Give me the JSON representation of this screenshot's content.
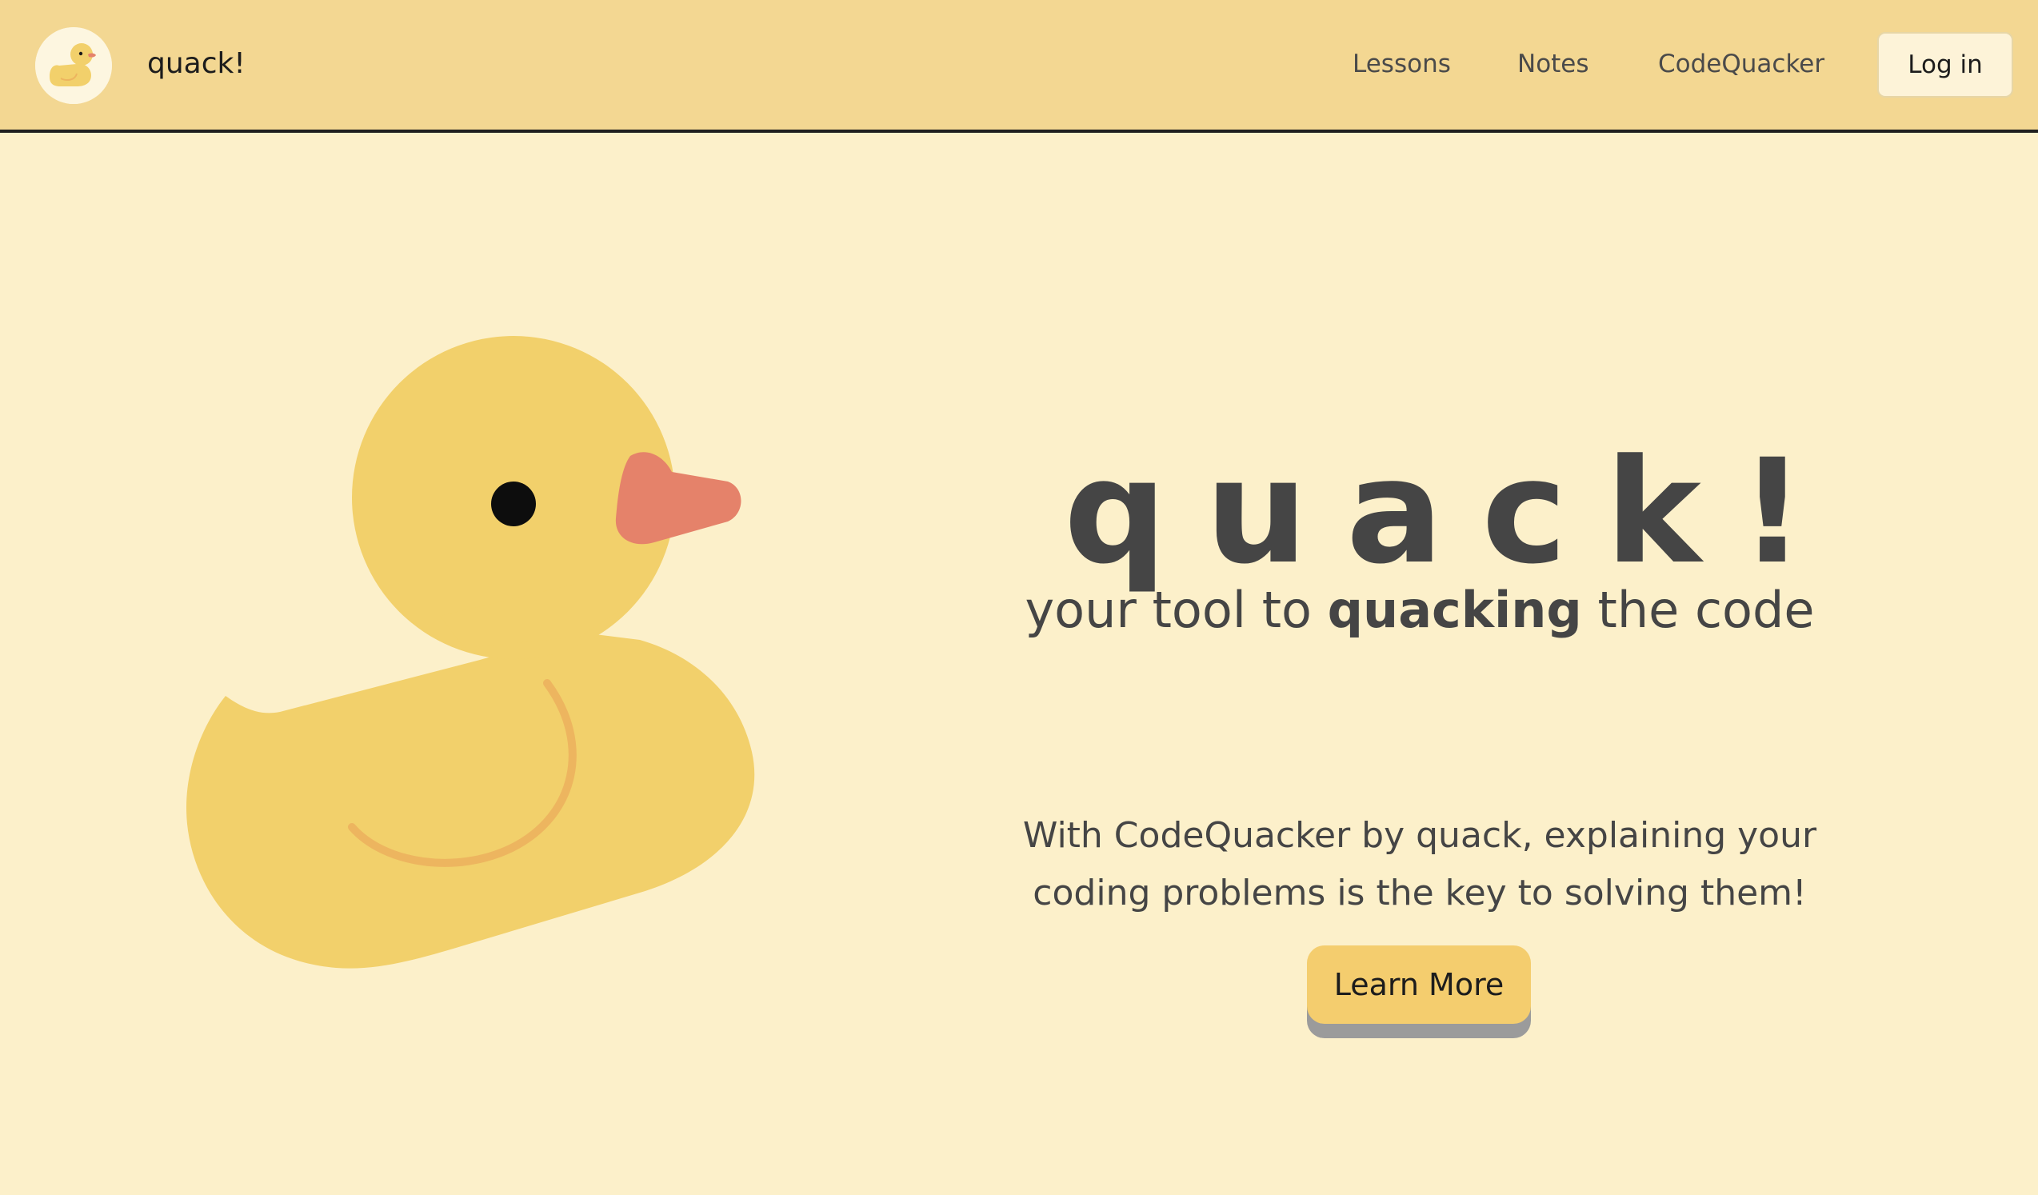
{
  "navbar": {
    "brand": {
      "logo_icon": "duck-logo-icon",
      "name": "quack!"
    },
    "links": [
      {
        "label": "Lessons"
      },
      {
        "label": "Notes"
      },
      {
        "label": "CodeQuacker"
      }
    ],
    "login_label": "Log in"
  },
  "hero": {
    "image_icon": "rubber-duck-illustration",
    "title": "quack!",
    "tagline": {
      "before": "your tool to",
      "emphasis": "quacking",
      "after": "the code"
    },
    "description": "With CodeQuacker by quack, explaining your coding problems is the key to solving them!",
    "cta_label": "Learn More"
  },
  "colors": {
    "page_background": "#fcf0ca",
    "navbar_background": "#f3d792",
    "duck_body": "#f2d06b",
    "duck_beak": "#e5826a",
    "duck_wing": "#edb55f",
    "cta_background": "#f4cd6e",
    "cta_shadow": "#9b9b9b",
    "text_primary": "#454545"
  }
}
